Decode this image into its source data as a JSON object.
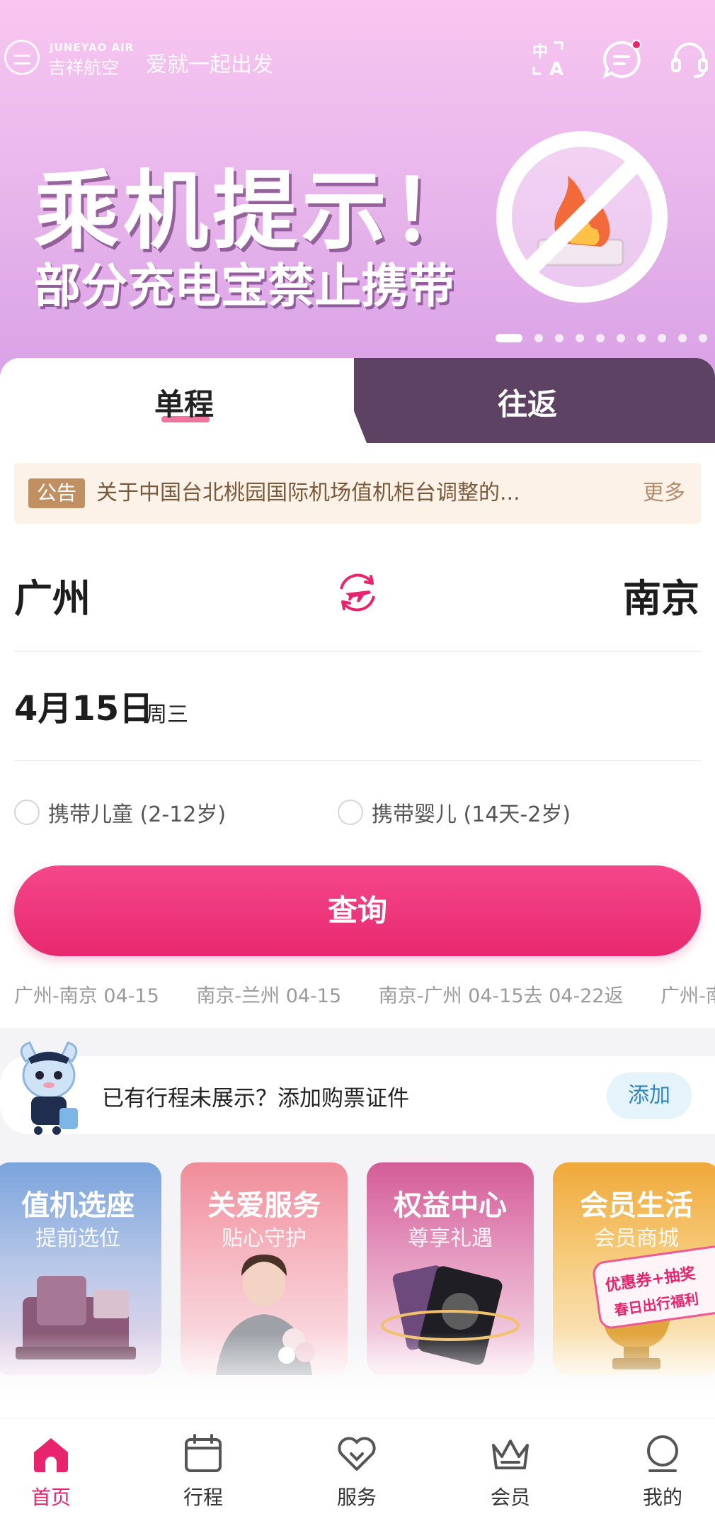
{
  "header": {
    "logo_en": "JUNEYAO AIR",
    "logo_cn": "吉祥航空",
    "slogan": "爱就一起出发"
  },
  "banner": {
    "title": "乘机提示！",
    "subtitle": "部分充电宝禁止携带",
    "slide_count": 10,
    "active_slide": 1
  },
  "tabs": {
    "oneway": "单程",
    "roundtrip": "往返",
    "active": "oneway"
  },
  "notice": {
    "tag": "公告",
    "text": "关于中国台北桃园国际机场值机柜台调整的...",
    "more": "更多"
  },
  "route": {
    "from": "广州",
    "to": "南京"
  },
  "date": {
    "main": "4月15日",
    "weekday": "周三"
  },
  "options": {
    "child": "携带儿童 (2-12岁)",
    "infant": "携带婴儿 (14天-2岁)"
  },
  "search_label": "查询",
  "history": [
    "广州-南京 04-15",
    "南京-兰州 04-15",
    "南京-广州 04-15去 04-22返",
    "广州-南"
  ],
  "add_trip": {
    "text": "已有行程未展示？添加购票证件",
    "button": "添加"
  },
  "services": [
    {
      "title": "值机选座",
      "subtitle": "提前选位",
      "color_top": "#7aa4dc",
      "color_bottom": "#e9d5e6"
    },
    {
      "title": "关爱服务",
      "subtitle": "贴心守护",
      "color_top": "#f08c9a",
      "color_bottom": "#fae4e8"
    },
    {
      "title": "权益中心",
      "subtitle": "尊享礼遇",
      "color_top": "#d45c98",
      "color_bottom": "#f6dde9"
    },
    {
      "title": "会员生活",
      "subtitle": "会员商城",
      "color_top": "#f0a83a",
      "color_bottom": "#fbe9c7"
    }
  ],
  "promo_badge": {
    "line1": "优惠券+抽奖",
    "line2": "春日出行福利"
  },
  "nav": [
    {
      "label": "首页",
      "icon": "home-icon",
      "active": true
    },
    {
      "label": "行程",
      "icon": "calendar-icon",
      "active": false
    },
    {
      "label": "服务",
      "icon": "heart-icon",
      "active": false
    },
    {
      "label": "会员",
      "icon": "crown-icon",
      "active": false
    },
    {
      "label": "我的",
      "icon": "profile-icon",
      "active": false
    }
  ],
  "colors": {
    "accent": "#e8246e",
    "tab_dark": "#5e4263",
    "notice_tag": "#c09062"
  }
}
